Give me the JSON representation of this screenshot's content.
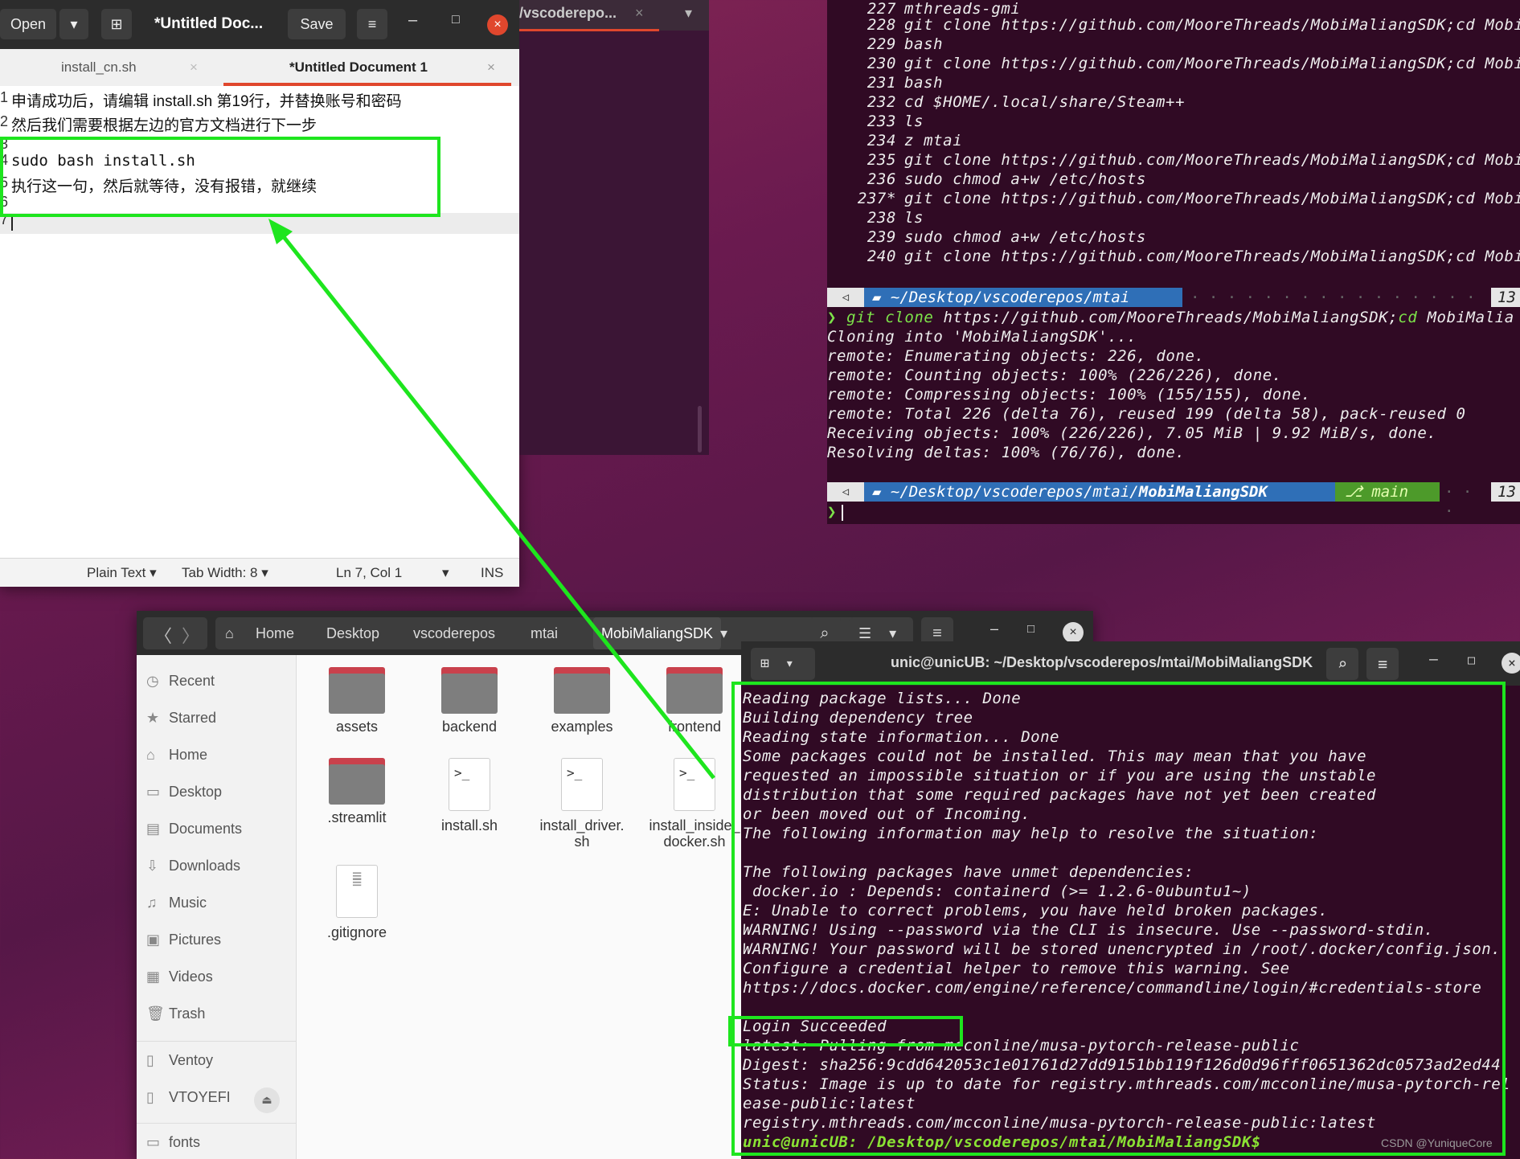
{
  "editor": {
    "open_label": "Open",
    "title": "*Untitled Doc...",
    "save_label": "Save",
    "tabs": [
      {
        "label": "install_cn.sh"
      },
      {
        "label": "*Untitled Document 1"
      }
    ],
    "line_numbers": [
      "1",
      "2",
      "3",
      "4",
      "5",
      "6",
      "7"
    ],
    "lines": [
      "申请成功后，请编辑 install.sh 第19行，并替换账号和密码",
      "然后我们需要根据左边的官方文档进行下一步",
      "",
      "sudo bash install.sh",
      "执行这一句，然后就等待，没有报错，就继续",
      "",
      ""
    ],
    "status": {
      "language": "Plain Text",
      "tab_width": "Tab Width: 8",
      "position": "Ln 7, Col 1",
      "mode": "INS"
    }
  },
  "vscode": {
    "tab_label": "/vscoderepo..."
  },
  "right_terminal": {
    "history": [
      {
        "n": "227",
        "cmd": "mthreads-gmi"
      },
      {
        "n": "228",
        "cmd": "git clone https://github.com/MooreThreads/MobiMaliangSDK;cd Mobi"
      },
      {
        "n": "229",
        "cmd": "bash"
      },
      {
        "n": "230",
        "cmd": "git clone https://github.com/MooreThreads/MobiMaliangSDK;cd Mobi"
      },
      {
        "n": "231",
        "cmd": "bash"
      },
      {
        "n": "232",
        "cmd": "cd $HOME/.local/share/Steam++"
      },
      {
        "n": "233",
        "cmd": "ls"
      },
      {
        "n": "234",
        "cmd": "z mtai"
      },
      {
        "n": "235",
        "cmd": "git clone https://github.com/MooreThreads/MobiMaliangSDK;cd Mobi"
      },
      {
        "n": "236",
        "cmd": "sudo chmod a+w /etc/hosts"
      },
      {
        "n": "237*",
        "cmd": "git clone https://github.com/MooreThreads/MobiMaliangSDK;cd Mobi"
      },
      {
        "n": "238",
        "cmd": "ls"
      },
      {
        "n": "239",
        "cmd": "sudo chmod a+w /etc/hosts"
      },
      {
        "n": "240",
        "cmd": "git clone https://github.com/MooreThreads/MobiMaliangSDK;cd Mobi"
      }
    ],
    "prompt1_path": "~/Desktop/vscoderepos/mtai",
    "prompt1_right": "13",
    "cmd_git": "git clone",
    "cmd_url": "https://github.com/MooreThreads/MobiMaliangSDK;",
    "cmd_cd": "cd",
    "cmd_rest": "MobiMalia",
    "output": [
      "Cloning into 'MobiMaliangSDK'...",
      "remote: Enumerating objects: 226, done.",
      "remote: Counting objects: 100% (226/226), done.",
      "remote: Compressing objects: 100% (155/155), done.",
      "remote: Total 226 (delta 76), reused 199 (delta 58), pack-reused 0",
      "Receiving objects: 100% (226/226), 7.05 MiB | 9.92 MiB/s, done.",
      "Resolving deltas: 100% (76/76), done."
    ],
    "prompt2_path": "~/Desktop/vscoderepos/mtai/",
    "prompt2_bold": "MobiMaliangSDK",
    "prompt2_branch": "main",
    "prompt2_right": "13"
  },
  "files": {
    "breadcrumbs": [
      "Home",
      "Desktop",
      "vscoderepos",
      "mtai",
      "MobiMaliangSDK"
    ],
    "sidebar": [
      {
        "label": "Recent",
        "icon": "clock-icon"
      },
      {
        "label": "Starred",
        "icon": "star-icon"
      },
      {
        "label": "Home",
        "icon": "home-icon"
      },
      {
        "label": "Desktop",
        "icon": "desktop-icon"
      },
      {
        "label": "Documents",
        "icon": "document-icon"
      },
      {
        "label": "Downloads",
        "icon": "download-icon"
      },
      {
        "label": "Music",
        "icon": "music-icon"
      },
      {
        "label": "Pictures",
        "icon": "picture-icon"
      },
      {
        "label": "Videos",
        "icon": "video-icon"
      },
      {
        "label": "Trash",
        "icon": "trash-icon"
      },
      {
        "label": "Ventoy",
        "icon": "drive-icon"
      },
      {
        "label": "VTOYEFI",
        "icon": "drive-icon"
      },
      {
        "label": "fonts",
        "icon": "folder-icon"
      }
    ],
    "items": [
      {
        "name": "assets",
        "type": "folder"
      },
      {
        "name": "backend",
        "type": "folder"
      },
      {
        "name": "examples",
        "type": "folder"
      },
      {
        "name": "frontend",
        "type": "folder"
      },
      {
        "name": ".streamlit",
        "type": "folder"
      },
      {
        "name": "install.sh",
        "type": "script"
      },
      {
        "name": "install_driver.\nsh",
        "type": "script"
      },
      {
        "name": "install_inside_\ndocker.sh",
        "type": "script"
      },
      {
        "name": ".gitignore",
        "type": "text"
      }
    ]
  },
  "bottom_terminal": {
    "title": "unic@unicUB: ~/Desktop/vscoderepos/mtai/MobiMaliangSDK",
    "lines": [
      "Reading package lists... Done",
      "Building dependency tree",
      "Reading state information... Done",
      "Some packages could not be installed. This may mean that you have",
      "requested an impossible situation or if you are using the unstable",
      "distribution that some required packages have not yet been created",
      "or been moved out of Incoming.",
      "The following information may help to resolve the situation:",
      "",
      "The following packages have unmet dependencies:",
      " docker.io : Depends: containerd (>= 1.2.6-0ubuntu1~)",
      "E: Unable to correct problems, you have held broken packages.",
      "WARNING! Using --password via the CLI is insecure. Use --password-stdin.",
      "WARNING! Your password will be stored unencrypted in /root/.docker/config.json.",
      "Configure a credential helper to remove this warning. See",
      "https://docs.docker.com/engine/reference/commandline/login/#credentials-store",
      "",
      "Login Succeeded",
      "latest: Pulling from mcconline/musa-pytorch-release-public",
      "Digest: sha256:9cdd642053c1e01761d27dd9151bb119f126d0d96fff0651362dc0573ad2ed44",
      "Status: Image is up to date for registry.mthreads.com/mcconline/musa-pytorch-rel",
      "ease-public:latest",
      "registry.mthreads.com/mcconline/musa-pytorch-release-public:latest",
      "unic@unicUB: /Desktop/vscoderepos/mtai/MobiMaliangSDK$"
    ]
  },
  "watermark": "CSDN @YuniqueCore",
  "colors": {
    "highlight": "#1ee51e",
    "terminal_bg": "#300a24",
    "prompt_blue": "#2f6fb7",
    "close_red": "#e0472d"
  }
}
